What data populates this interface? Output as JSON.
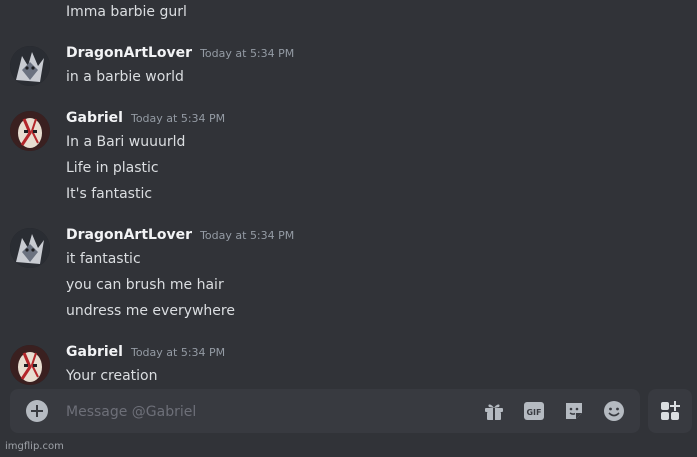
{
  "theme": {
    "background": "#313338",
    "text": "#dbdee1",
    "username": "#f2f3f5",
    "timestamp": "#949ba4",
    "composer": "#383a40"
  },
  "messages": [
    {
      "author": null,
      "lines": [
        "Imma barbie gurl"
      ]
    },
    {
      "author": "DragonArtLover",
      "timestamp": "Today at 5:34 PM",
      "avatar": "dragon-avatar",
      "lines": [
        "in a barbie world"
      ]
    },
    {
      "author": "Gabriel",
      "timestamp": "Today at 5:34 PM",
      "avatar": "hollow-mask-avatar",
      "lines": [
        "In a Bari wuuurld",
        "Life in plastic",
        "It's fantastic"
      ]
    },
    {
      "author": "DragonArtLover",
      "timestamp": "Today at 5:34 PM",
      "avatar": "dragon-avatar",
      "lines": [
        "it fantastic",
        "you can brush me hair",
        "undress me everywhere"
      ]
    },
    {
      "author": "Gabriel",
      "timestamp": "Today at 5:34 PM",
      "avatar": "hollow-mask-avatar",
      "lines": [
        "Your creation"
      ]
    }
  ],
  "composer": {
    "placeholder": "Message @Gabriel",
    "icons": [
      "plus-circle-icon",
      "gift-icon",
      "gif-icon",
      "sticker-icon",
      "emoji-icon"
    ],
    "apps_icon": "apps-icon"
  },
  "watermark": "imgflip.com"
}
